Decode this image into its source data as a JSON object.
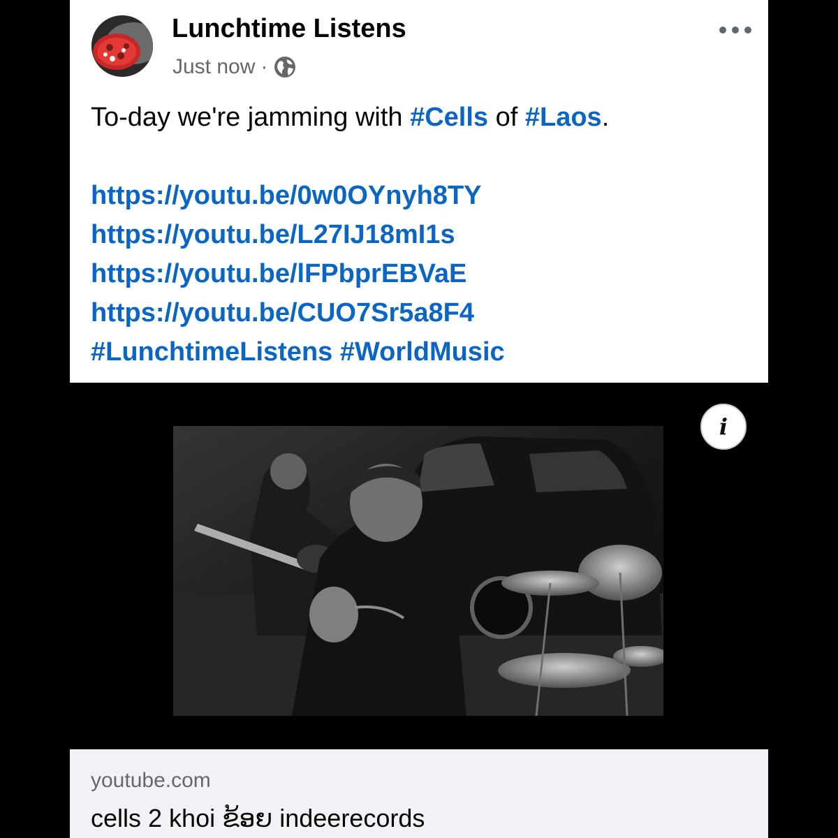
{
  "post": {
    "author": "Lunchtime Listens",
    "timestamp": "Just now",
    "separator": "·",
    "audience_icon": "globe-icon",
    "more_icon": "more-options-icon",
    "avatar_icon": "pizza-avatar",
    "text": {
      "intro_prefix": "To-day we're jamming with ",
      "tag_cells": "#Cells",
      "intro_middle": " of ",
      "tag_laos": "#Laos",
      "intro_suffix": ".",
      "links": [
        "https://youtu.be/0w0OYnyh8TY",
        "https://youtu.be/L27IJ18mI1s",
        "https://youtu.be/lFPbprEBVaE",
        "https://youtu.be/CUO7Sr5a8F4"
      ],
      "hashtags": [
        "#LunchtimeListens",
        "#WorldMusic"
      ]
    }
  },
  "media": {
    "info_label": "i",
    "info_icon": "info-icon",
    "thumbnail": "video-thumbnail"
  },
  "link_preview": {
    "domain": "youtube.com",
    "title": "cells 2 khoi ຂ້ອຍ indeerecords"
  },
  "colors": {
    "accent": "#0a66c2",
    "text": "#050505",
    "secondary": "#65676b",
    "background": "#000000",
    "card": "#ffffff",
    "preview_bg": "#f0f2f5"
  }
}
